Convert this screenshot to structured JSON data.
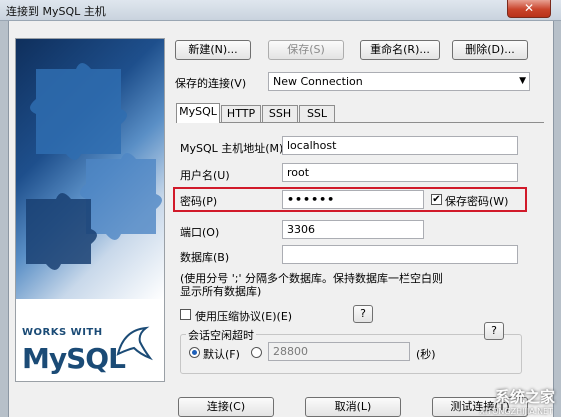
{
  "window": {
    "title": "连接到 MySQL 主机",
    "close_glyph": "✕"
  },
  "toolbar": {
    "new_label": "新建(N)...",
    "save_label": "保存(S)",
    "rename_label": "重命名(R)...",
    "delete_label": "删除(D)..."
  },
  "saved_connection": {
    "label": "保存的连接(V)",
    "value": "New Connection"
  },
  "tabs": [
    {
      "label": "MySQL",
      "active": true
    },
    {
      "label": "HTTP",
      "active": false
    },
    {
      "label": "SSH",
      "active": false
    },
    {
      "label": "SSL",
      "active": false
    }
  ],
  "form": {
    "host_label": "MySQL 主机地址(M)",
    "host_value": "localhost",
    "user_label": "用户名(U)",
    "user_value": "root",
    "password_label": "密码(P)",
    "password_value": "••••••",
    "save_password_label": "保存密码(W)",
    "save_password_checked": true,
    "port_label": "端口(O)",
    "port_value": "3306",
    "database_label": "数据库(B)",
    "database_value": "",
    "database_hint_line1": "(使用分号 ';' 分隔多个数据库。保持数据库一栏空白则",
    "database_hint_line2": "显示所有数据库)",
    "compression_label": "使用压缩协议(E)(E)",
    "compression_checked": false,
    "help_label": "?",
    "session_group_label": "会话空闲超时",
    "default_label": "默认(F)",
    "default_selected": true,
    "timeout_value": "28800",
    "seconds_label": "(秒)"
  },
  "footer": {
    "connect_label": "连接(C)",
    "cancel_label": "取消(L)",
    "test_label": "测试连接(T)"
  },
  "logo": {
    "works_with": "WORKS WITH",
    "mysql": "MySQL"
  },
  "watermark": {
    "text": "系统之家",
    "url": "XITONGZHIJIA.NET"
  },
  "colors": {
    "highlight": "#d11a2a",
    "mysql_blue": "#1b4b76"
  }
}
